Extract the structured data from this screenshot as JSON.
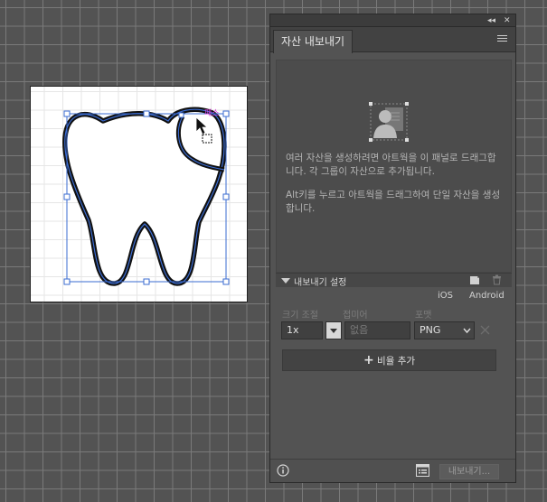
{
  "artboard": {
    "path_label": "패스"
  },
  "panel": {
    "topbar": {
      "collapse_glyph": "◂◂",
      "close_glyph": "✕"
    },
    "tab_label": "자산 내보내기",
    "help_text_1": "여러 자산을 생성하려면 아트웍을 이 패널로 드래그합니다. 각 그룹이 자산으로 추가됩니다.",
    "help_text_2": "Alt키를 누르고 아트웍을 드래그하여 단일 자산을 생성합니다.",
    "settings": {
      "title": "내보내기 설정",
      "presets": [
        "iOS",
        "Android"
      ],
      "columns": {
        "scale": "크기 조절",
        "suffix": "접미어",
        "format": "포맷"
      },
      "scale_value": "1x",
      "suffix_placeholder": "없음",
      "format_value": "PNG",
      "add_scale_label": "비율 추가"
    },
    "export_label": "내보내기..."
  },
  "colors": {
    "accent": "#3a6bd1",
    "path_label": "#e040e0"
  }
}
